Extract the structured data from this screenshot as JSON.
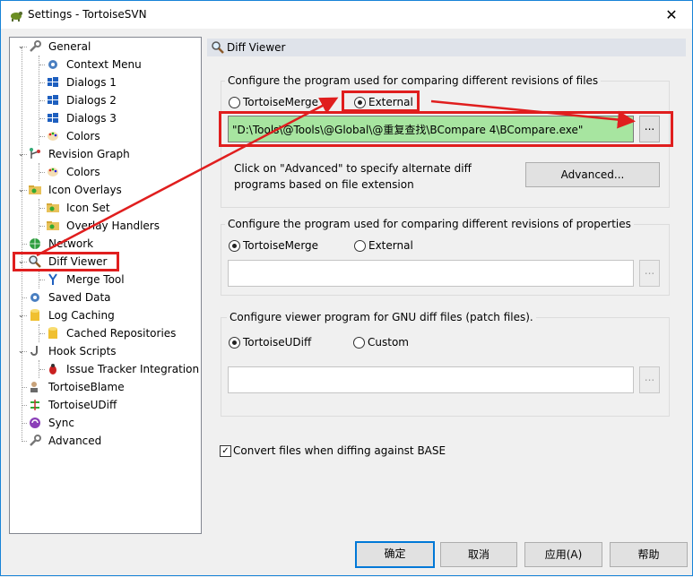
{
  "window": {
    "title": "Settings - TortoiseSVN",
    "close_glyph": "✕"
  },
  "tree": {
    "items": [
      {
        "label": "General",
        "icon": "wrench-icon",
        "level": 0,
        "expanded": true
      },
      {
        "label": "Context Menu",
        "icon": "gear-icon",
        "level": 1
      },
      {
        "label": "Dialogs 1",
        "icon": "windows-icon",
        "level": 1
      },
      {
        "label": "Dialogs 2",
        "icon": "windows-icon",
        "level": 1
      },
      {
        "label": "Dialogs 3",
        "icon": "windows-icon",
        "level": 1
      },
      {
        "label": "Colors",
        "icon": "palette-icon",
        "level": 1
      },
      {
        "label": "Revision Graph",
        "icon": "graph-icon",
        "level": 0,
        "expanded": true
      },
      {
        "label": "Colors",
        "icon": "palette-icon",
        "level": 1
      },
      {
        "label": "Icon Overlays",
        "icon": "folder-icon",
        "level": 0,
        "expanded": true
      },
      {
        "label": "Icon Set",
        "icon": "folder-icon",
        "level": 1
      },
      {
        "label": "Overlay Handlers",
        "icon": "folder-icon",
        "level": 1
      },
      {
        "label": "Network",
        "icon": "globe-icon",
        "level": 0
      },
      {
        "label": "Diff Viewer",
        "icon": "magnifier-icon",
        "level": 0,
        "expanded": true,
        "selected": true
      },
      {
        "label": "Merge Tool",
        "icon": "merge-icon",
        "level": 1
      },
      {
        "label": "Saved Data",
        "icon": "gear-icon",
        "level": 0
      },
      {
        "label": "Log Caching",
        "icon": "database-icon",
        "level": 0,
        "expanded": true
      },
      {
        "label": "Cached Repositories",
        "icon": "database-icon",
        "level": 1
      },
      {
        "label": "Hook Scripts",
        "icon": "hook-icon",
        "level": 0,
        "expanded": true
      },
      {
        "label": "Issue Tracker Integration",
        "icon": "bug-icon",
        "level": 1
      },
      {
        "label": "TortoiseBlame",
        "icon": "blame-icon",
        "level": 0
      },
      {
        "label": "TortoiseUDiff",
        "icon": "udiff-icon",
        "level": 0
      },
      {
        "label": "Sync",
        "icon": "sync-icon",
        "level": 0
      },
      {
        "label": "Advanced",
        "icon": "wrench-icon",
        "level": 0
      }
    ]
  },
  "panel": {
    "title": "Diff Viewer",
    "group_files": {
      "label": "Configure the program used for comparing different revisions of files",
      "radio_tortoisemerge": "TortoiseMerge",
      "radio_external": "External",
      "selected": "External",
      "path_value": "\"D:\\Tools\\@Tools\\@Global\\@重复查找\\BCompare 4\\BCompare.exe\"",
      "browse_label": "...",
      "advanced_note_line1": "Click on \"Advanced\" to specify alternate diff",
      "advanced_note_line2": "programs based on file extension",
      "advanced_button": "Advanced..."
    },
    "group_props": {
      "label": "Configure the program used for comparing different revisions of properties",
      "radio_tortoisemerge": "TortoiseMerge",
      "radio_external": "External",
      "selected": "TortoiseMerge",
      "path_value": "",
      "browse_label": "..."
    },
    "group_patch": {
      "label": "Configure viewer program for GNU diff files (patch files).",
      "radio_udiff": "TortoiseUDiff",
      "radio_custom": "Custom",
      "selected": "TortoiseUDiff",
      "path_value": "",
      "browse_label": "..."
    },
    "convert_checkbox": {
      "label": "Convert files when diffing against BASE",
      "checked": true
    }
  },
  "footer": {
    "ok": "确定",
    "cancel": "取消",
    "apply": "应用(A)",
    "help": "帮助"
  },
  "colors": {
    "annotation_red": "#e01e1e",
    "path_highlight_green": "#a7e5a0",
    "accent_blue": "#0078d7"
  }
}
